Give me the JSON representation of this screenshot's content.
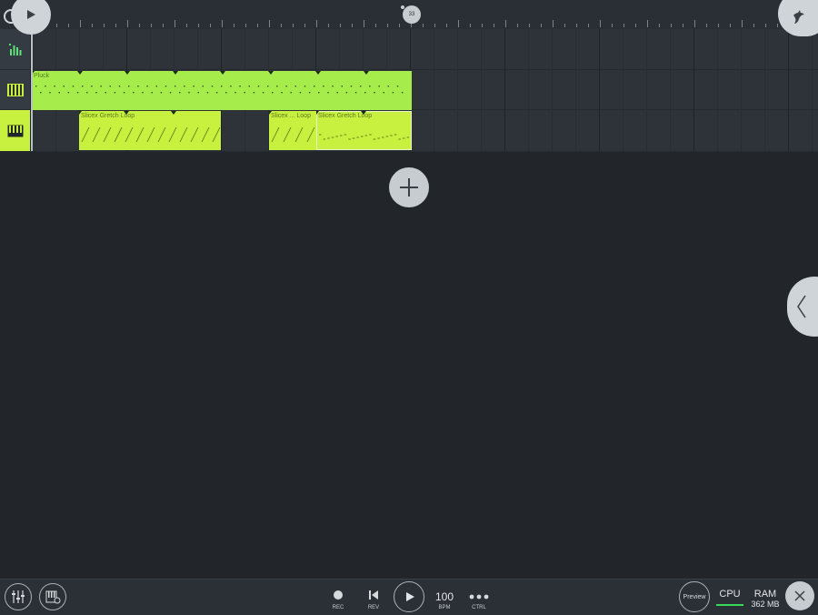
{
  "ruler": {
    "marker_label": "33"
  },
  "tracks": [
    {
      "icon": "mixer-levels-icon"
    },
    {
      "icon": "piano-icon"
    },
    {
      "icon": "piano-icon",
      "selected": true
    }
  ],
  "clips": {
    "pluck": {
      "label": "Pluck",
      "color": "#a6ec4a"
    },
    "slicex1": {
      "label": "Slicex Gretch Loop",
      "color": "#c8f03e"
    },
    "slicex2": {
      "label": "Slicex ... Loop",
      "color": "#c8f03e"
    },
    "slicex3": {
      "label": "Slicex Gretch Loop",
      "color": "#c8f03e"
    }
  },
  "transport": {
    "rec_label": "REC",
    "rev_label": "REV",
    "bpm_value": "100",
    "bpm_label": "BPM",
    "ctrl_label": "CTRL"
  },
  "right_panel": {
    "preview_label": "Preview",
    "cpu_label": "CPU",
    "ram_label": "RAM",
    "ram_value": "362 MB"
  },
  "colors": {
    "accent_green": "#c8f03e",
    "pluck_green": "#a6ec4a",
    "background": "#22262b"
  }
}
